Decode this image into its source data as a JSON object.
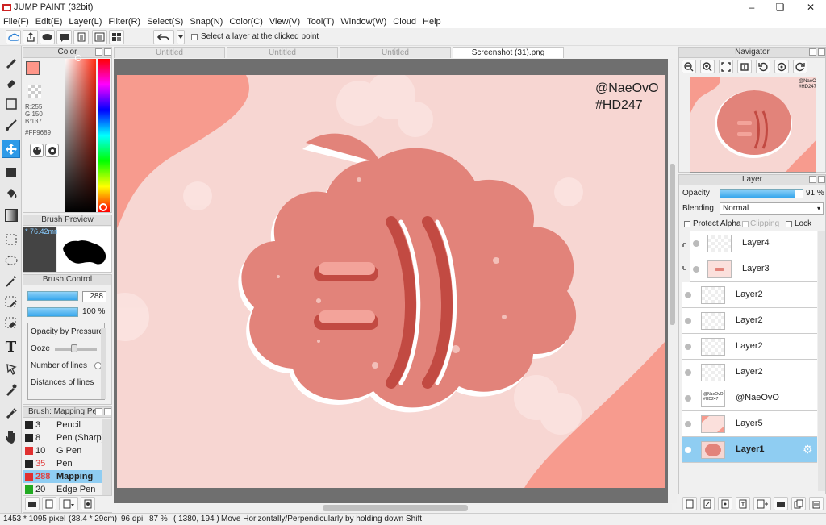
{
  "window": {
    "title": "JUMP PAINT (32bit)"
  },
  "menu": [
    "File(F)",
    "Edit(E)",
    "Layer(L)",
    "Filter(R)",
    "Select(S)",
    "Snap(N)",
    "Color(C)",
    "View(V)",
    "Tool(T)",
    "Window(W)",
    "Cloud",
    "Help"
  ],
  "toolbar": {
    "option_label": "Select a layer at the clicked point"
  },
  "tabs": [
    "Untitled",
    "Untitled",
    "Untitled",
    "Screenshot (31).png"
  ],
  "color_panel": {
    "title": "Color",
    "r": "R:255",
    "g": "G:150",
    "b": "B:137",
    "hex": "#FF9689",
    "current": "#FF9689"
  },
  "brush_preview": {
    "title": "Brush Preview",
    "size": "* 76.42mm"
  },
  "brush_control": {
    "title": "Brush Control",
    "size_value": "288",
    "opacity_value": "100 %",
    "opt1": "Opacity by Pressure",
    "opt2": "Ooze",
    "opt3": "Number of lines",
    "opt4": "Distances of lines"
  },
  "brush_list": {
    "title": "Brush: Mapping Pen",
    "items": [
      {
        "num": "3",
        "label": "Pencil",
        "color": "#222222"
      },
      {
        "num": "8",
        "label": "Pen (Sharp)",
        "color": "#222222"
      },
      {
        "num": "10",
        "label": "G Pen",
        "color": "#e03030"
      },
      {
        "num": "35",
        "label": "Pen",
        "color": "#222222"
      },
      {
        "num": "288",
        "label": "Mapping",
        "color": "#e03030"
      },
      {
        "num": "20",
        "label": "Edge Pen",
        "color": "#22aa22"
      }
    ]
  },
  "canvas": {
    "watermark1": "@NaeOvO",
    "watermark2": "#HD247"
  },
  "navigator": {
    "title": "Navigator"
  },
  "layer_panel": {
    "title": "Layer",
    "opacity_label": "Opacity",
    "opacity_value": "91 %",
    "opacity_fraction": 0.91,
    "blending_label": "Blending",
    "blending_value": "Normal",
    "protect_alpha": "Protect Alpha",
    "clipping": "Clipping",
    "lock": "Lock",
    "layers": [
      "Layer4",
      "Layer3",
      "Layer2",
      "Layer2",
      "Layer2",
      "Layer2",
      "@NaeOvO",
      "Layer5",
      "Layer1"
    ],
    "thumb_text": "@NaeOvO #HD247"
  },
  "status": {
    "size": "1453 * 1095 pixel",
    "cm": "(38.4 * 29cm)",
    "dpi": "96 dpi",
    "zoom": "87 %",
    "coords": "( 1380, 194 )",
    "hint": "Move Horizontally/Perpendicularly by holding down Shift"
  }
}
